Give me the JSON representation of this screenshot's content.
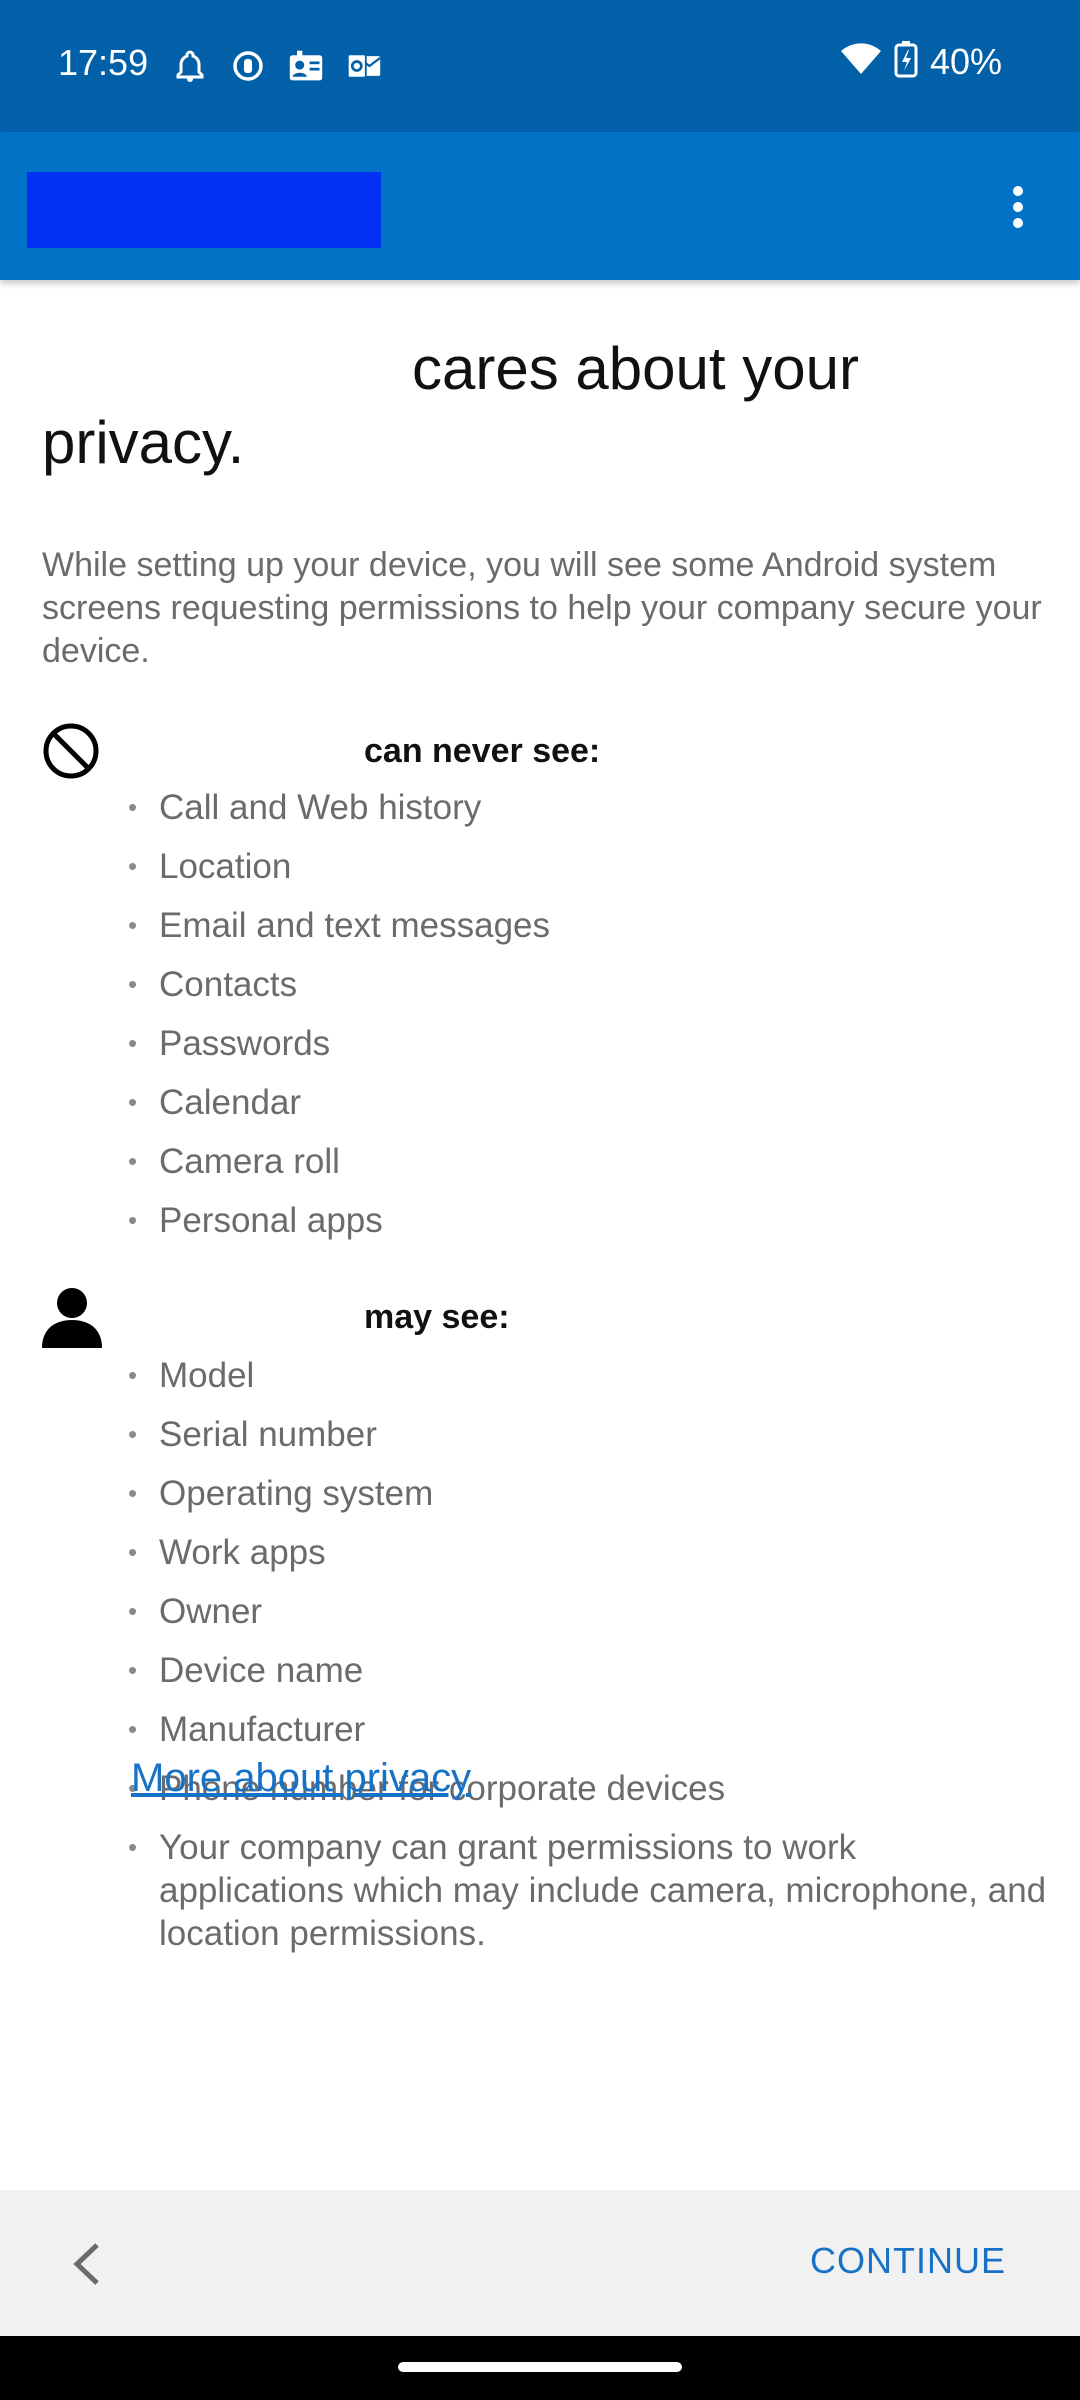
{
  "status_bar": {
    "time": "17:59",
    "battery": "40%",
    "icons": [
      "bell-icon",
      "circle-dot-icon",
      "contacts-card-icon",
      "outlook-icon",
      "wifi-icon",
      "battery-charging-icon"
    ]
  },
  "app_bar": {
    "menu_icon": "more-vert-icon"
  },
  "title": {
    "before": "",
    "text": "cares about your privacy."
  },
  "intro": "While setting up your device, you will see some Android system screens requesting permissions to help your company secure your device.",
  "never_see": {
    "heading": "can never see:",
    "icon": "block-icon",
    "items": [
      "Call and Web history",
      "Location",
      "Email and text messages",
      "Contacts",
      "Passwords",
      "Calendar",
      "Camera roll",
      "Personal apps"
    ]
  },
  "may_see": {
    "heading": "may see:",
    "icon": "person-icon",
    "items": [
      "Model",
      "Serial number",
      "Operating system",
      "Work apps",
      "Owner",
      "Device name",
      "Manufacturer",
      "Phone number for corporate devices",
      "Your company can grant permissions to work applications which may include camera, microphone, and location permissions."
    ]
  },
  "link": "More about privacy",
  "footer": {
    "continue": "CONTINUE",
    "back_icon": "chevron-left-icon"
  },
  "colors": {
    "status_bar": "#0160a8",
    "app_bar": "#0173c7",
    "accent": "#1772c7"
  }
}
